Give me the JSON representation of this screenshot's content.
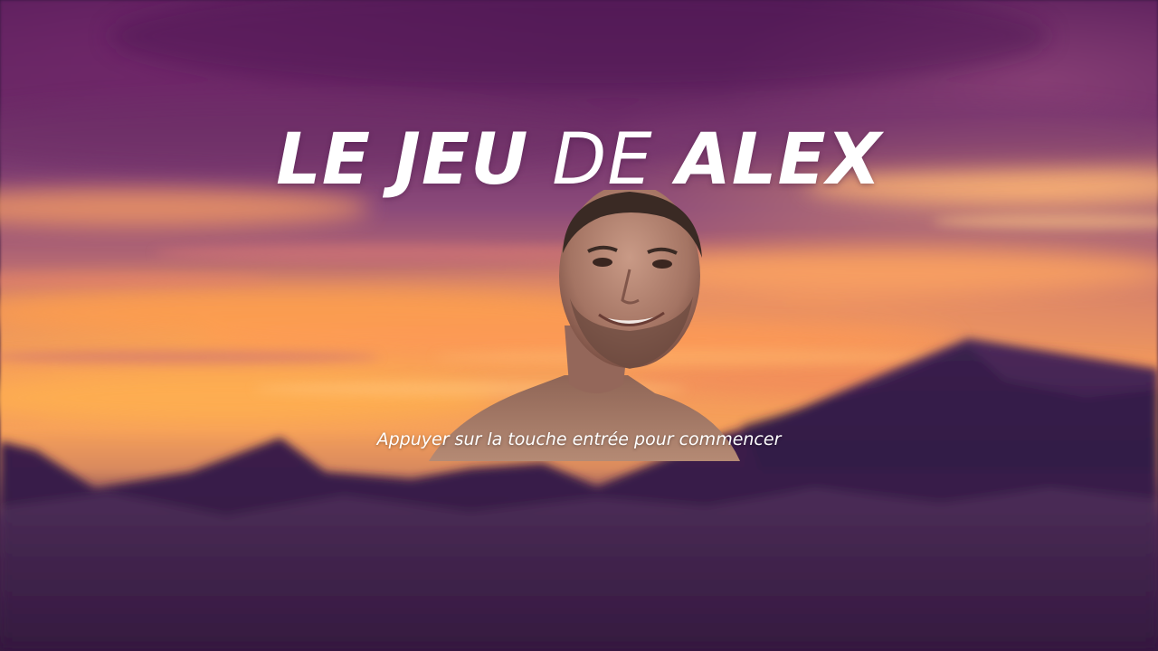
{
  "game": {
    "title_parts": {
      "word1": "LE",
      "word2": "JEU",
      "word3": "DE",
      "word4": "ALEX"
    },
    "start_prompt": "Appuyer sur la touche entrée pour commencer"
  },
  "colors": {
    "sky_top": "#5a1f5c",
    "sky_glow": "#f6a05a",
    "mountains": "#33173f",
    "text": "#ffffff"
  }
}
